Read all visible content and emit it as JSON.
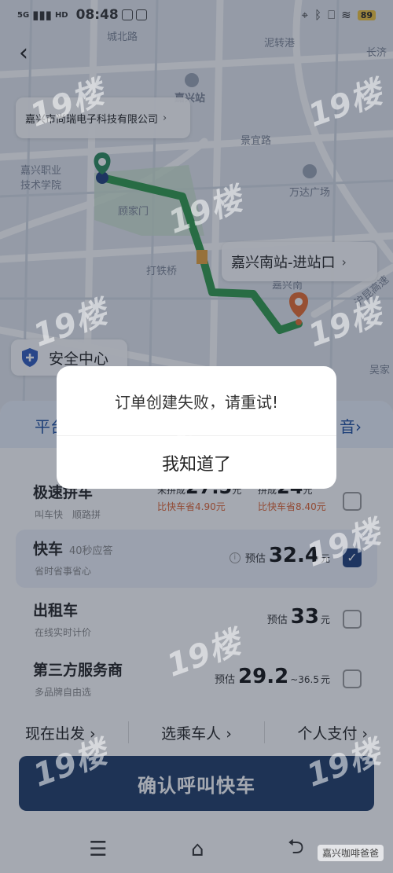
{
  "status_bar": {
    "network": "5G",
    "hd": "HD",
    "time": "08:48",
    "battery": "89"
  },
  "map": {
    "labels": [
      "城北路",
      "泥转港",
      "嘉兴站",
      "景宜路",
      "嘉兴职业技术学院",
      "万达广场",
      "顾家门",
      "打铁桥",
      "嘉兴南",
      "沪昆高速",
      "吴家",
      "长济"
    ],
    "pickup_label": "嘉兴市尚瑞电子科技有限公司",
    "destination_label": "嘉兴南站-进站口",
    "safety_center": "安全中心"
  },
  "banner": {
    "left": "平台",
    "right": "音"
  },
  "rides": [
    {
      "name": "极速拼车",
      "sub": [
        "叫车快",
        "顺路拼"
      ],
      "unpooled_label": "未拼成",
      "unpooled_price": "27.5",
      "unpooled_unit": "元",
      "unpooled_save": "比快车省4.90元",
      "pooled_label": "拼成",
      "pooled_price": "24",
      "pooled_unit": "元",
      "pooled_save": "比快车省8.40元",
      "checked": false
    },
    {
      "name": "快车",
      "tag": "40秒应答",
      "sub": [
        "省时省事省心"
      ],
      "prefix": "预估",
      "price": "32.4",
      "unit": "元",
      "checked": true
    },
    {
      "name": "出租车",
      "sub": [
        "在线实时计价"
      ],
      "prefix": "预估",
      "price": "33",
      "unit": "元",
      "checked": false
    },
    {
      "name": "第三方服务商",
      "sub": [
        "多品牌自由选"
      ],
      "prefix": "预估",
      "price": "29.2",
      "range": "~36.5",
      "unit": "元",
      "checked": false
    }
  ],
  "options": {
    "depart": "现在出发",
    "passenger": "选乘车人",
    "payment": "个人支付"
  },
  "confirm_button": "确认呼叫快车",
  "dialog": {
    "message": "订单创建失败，请重试!",
    "ok": "我知道了"
  },
  "watermark": "19楼",
  "wechat_tag": "嘉兴咖啡爸爸",
  "colors": {
    "route": "#3aa655",
    "confirm_bg": "#1e3b66",
    "save_text": "#e0622f",
    "banner_text": "#1c4e9e"
  }
}
